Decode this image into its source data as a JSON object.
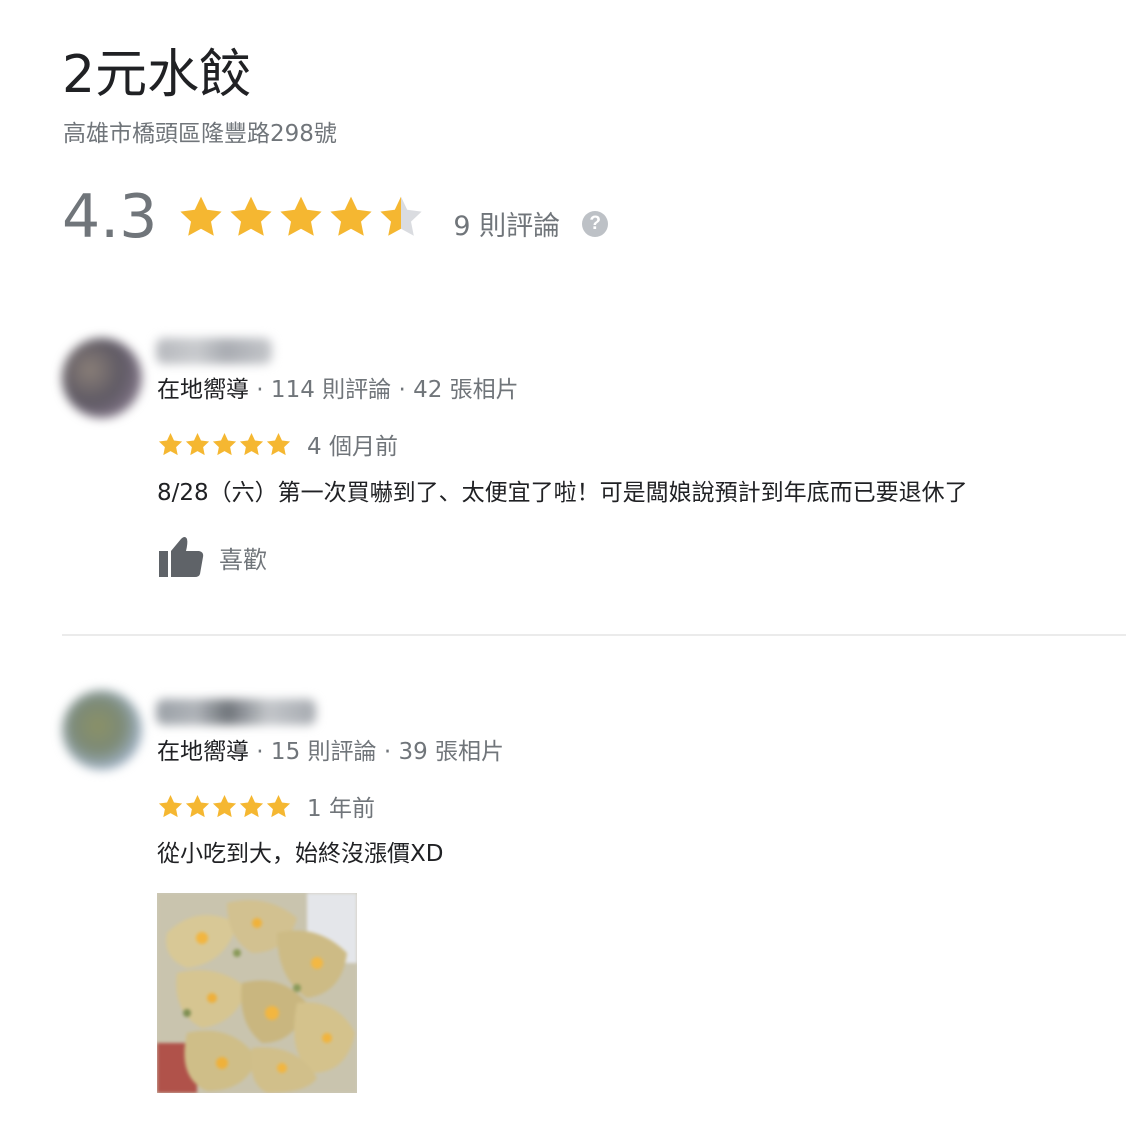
{
  "place": {
    "name": "2元水餃",
    "address": "高雄市橋頭區隆豐路298號",
    "rating": "4.3",
    "rating_stars": 4.3,
    "review_count": "9 則評論",
    "help_icon": "?"
  },
  "colors": {
    "star": "#f5b731",
    "star_empty": "#dadce0",
    "text_primary": "#202124",
    "text_secondary": "#70757a"
  },
  "reviews": [
    {
      "badge": "在地嚮導",
      "meta": " · 114 則評論 · 42 張相片",
      "stars": 5,
      "time": "4 個月前",
      "text": "8/28（六）第一次買嚇到了、太便宜了啦！可是闆娘說預計到年底而已要退休了",
      "like_label": "喜歡",
      "like_icon": "thumbs-up-icon"
    },
    {
      "badge": "在地嚮導",
      "meta": " · 15 則評論 · 39 張相片",
      "stars": 5,
      "time": "1 年前",
      "text": "從小吃到大，始終沒漲價XD",
      "photo_icon": "dumplings-photo"
    }
  ]
}
